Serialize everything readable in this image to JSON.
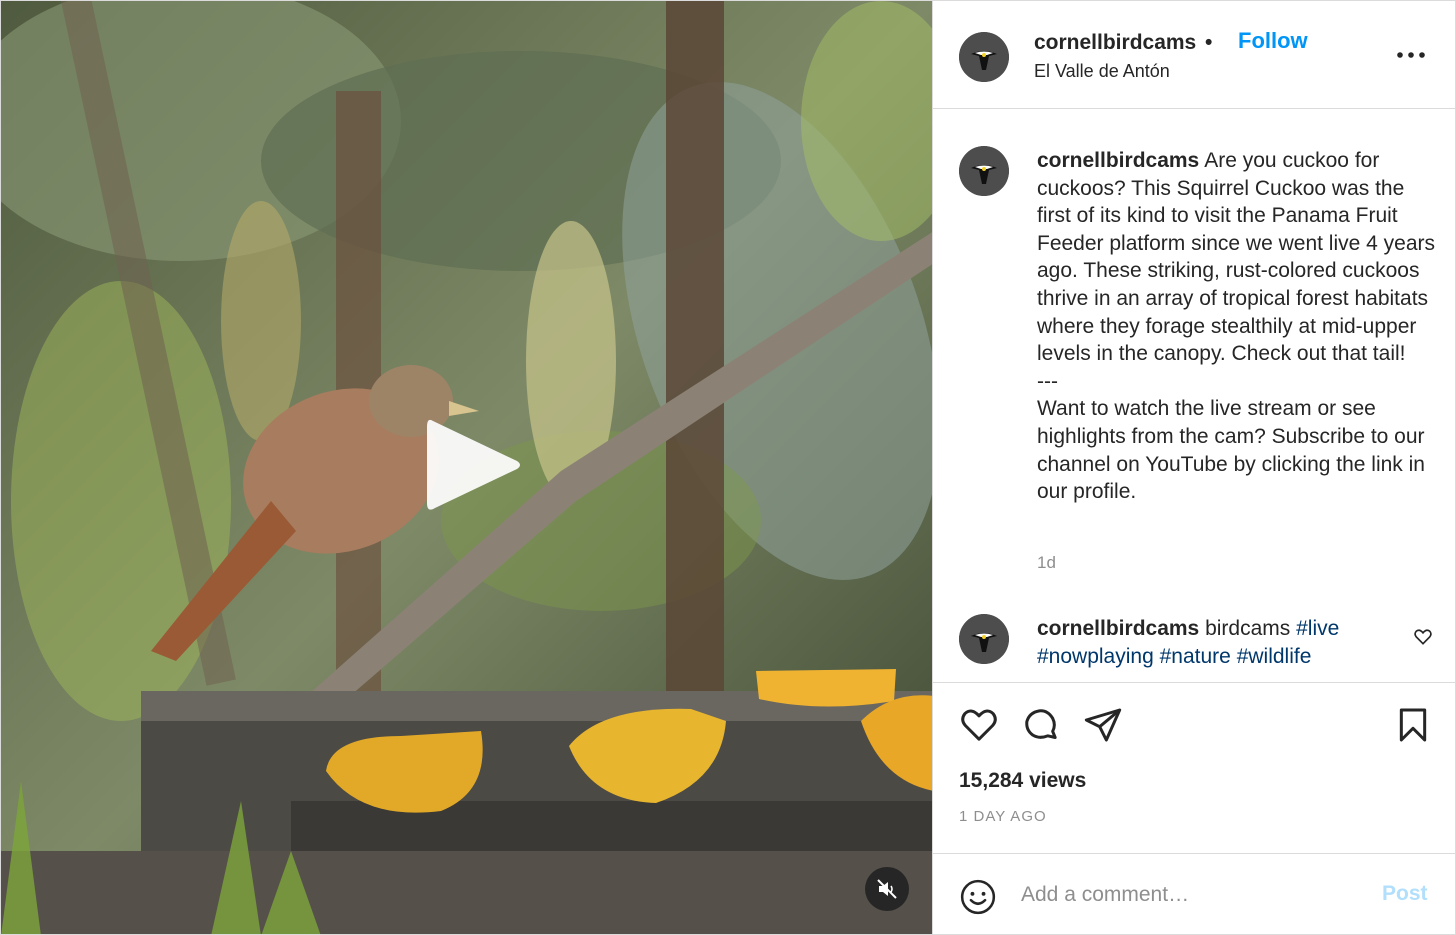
{
  "post": {
    "username": "cornellbirdcams",
    "separator": "•",
    "follow_label": "Follow",
    "location": "El Valle de Antón",
    "caption": "Are you cuckoo for cuckoos? This Squirrel Cuckoo was the first of its kind to visit the Panama Fruit Feeder platform since we went live 4 years ago. These striking, rust-colored cuckoos thrive in an array of tropical forest habitats where they forage stealthily at mid-upper levels in the canopy. Check out that tail!\n---\nWant to watch the live stream or see highlights from the cam? Subscribe to our channel on YouTube by clicking the link in our profile.",
    "age": "1d",
    "comment": {
      "username": "cornellbirdcams",
      "text_prefix": "birdcams",
      "hashtags": [
        "#live",
        "#nowplaying",
        "#nature",
        "#wildlife"
      ]
    },
    "views": "15,284 views",
    "date": "1 DAY AGO"
  },
  "comment_box": {
    "placeholder": "Add a comment…",
    "post_label": "Post"
  },
  "icons": {
    "play": "play-icon",
    "mute": "muted-speaker-icon",
    "more": "more-options-icon",
    "like": "heart-icon",
    "comment": "comment-bubble-icon",
    "share": "paper-plane-icon",
    "save": "bookmark-icon",
    "emoji": "smiley-icon"
  },
  "colors": {
    "accent": "#0095f6",
    "post_disabled": "#b2dffc",
    "hashtag": "#00376b",
    "muted_text": "#8e8e8e"
  }
}
